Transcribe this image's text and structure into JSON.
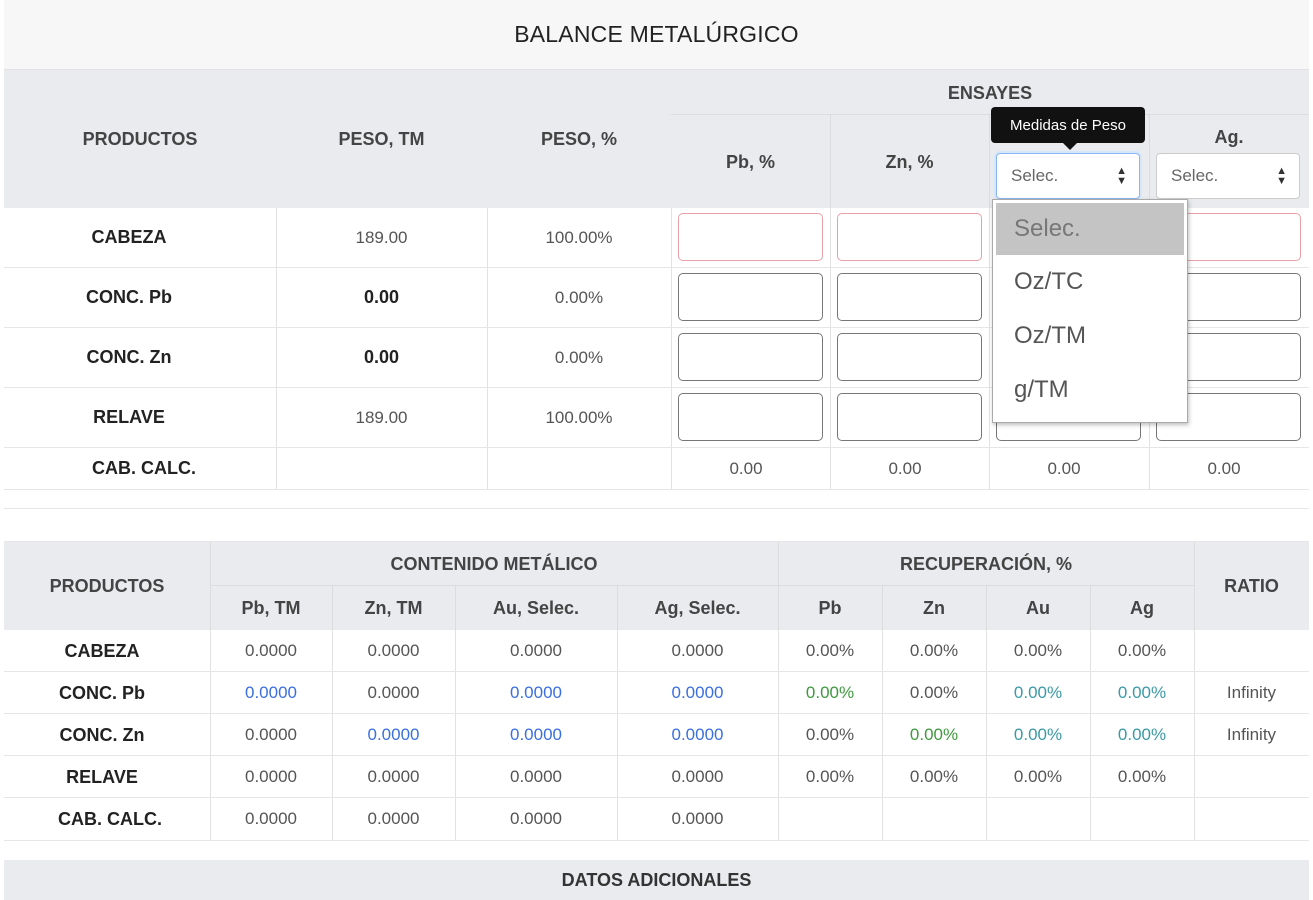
{
  "title": "BALANCE METALÚRGICO",
  "table1": {
    "headers": {
      "productos": "PRODUCTOS",
      "peso_tm": "PESO, TM",
      "peso_pct": "PESO, %",
      "ensayes": "ENSAYES",
      "pb": "Pb, %",
      "zn": "Zn, %",
      "ag": "Ag."
    },
    "selects": {
      "au_value": "Selec.",
      "ag_value": "Selec."
    },
    "tooltip": "Medidas de Peso",
    "dropdown_options": [
      "Selec.",
      "Oz/TC",
      "Oz/TM",
      "g/TM"
    ],
    "rows": [
      {
        "name": "CABEZA",
        "peso_tm": "189.00",
        "peso_pct": "100.00%"
      },
      {
        "name": "CONC. Pb",
        "peso_tm": "0.00",
        "peso_pct": "0.00%"
      },
      {
        "name": "CONC. Zn",
        "peso_tm": "0.00",
        "peso_pct": "0.00%"
      },
      {
        "name": "RELAVE",
        "peso_tm": "189.00",
        "peso_pct": "100.00%"
      }
    ],
    "calc_row": {
      "name": "CAB. CALC.",
      "values": [
        "0.00",
        "0.00",
        "0.00",
        "0.00"
      ]
    }
  },
  "table2": {
    "headers": {
      "productos": "PRODUCTOS",
      "contenido": "CONTENIDO METÁLICO",
      "recuperacion": "RECUPERACIÓN, %",
      "ratio": "RATIO",
      "sub": [
        "Pb, TM",
        "Zn, TM",
        "Au, Selec.",
        "Ag, Selec.",
        "Pb",
        "Zn",
        "Au",
        "Ag"
      ]
    },
    "rows": [
      {
        "name": "CABEZA",
        "values": [
          "0.0000",
          "0.0000",
          "0.0000",
          "0.0000",
          "0.00%",
          "0.00%",
          "0.00%",
          "0.00%"
        ],
        "ratio": ""
      },
      {
        "name": "CONC. Pb",
        "values": [
          "0.0000",
          "0.0000",
          "0.0000",
          "0.0000",
          "0.00%",
          "0.00%",
          "0.00%",
          "0.00%"
        ],
        "ratio": "Infinity"
      },
      {
        "name": "CONC. Zn",
        "values": [
          "0.0000",
          "0.0000",
          "0.0000",
          "0.0000",
          "0.00%",
          "0.00%",
          "0.00%",
          "0.00%"
        ],
        "ratio": "Infinity"
      },
      {
        "name": "RELAVE",
        "values": [
          "0.0000",
          "0.0000",
          "0.0000",
          "0.0000",
          "0.00%",
          "0.00%",
          "0.00%",
          "0.00%"
        ],
        "ratio": ""
      },
      {
        "name": "CAB. CALC.",
        "values": [
          "0.0000",
          "0.0000",
          "0.0000",
          "0.0000"
        ],
        "ratio": ""
      }
    ]
  },
  "footer": "DATOS ADICIONALES",
  "colors": {
    "highlight_blue": "#3b6fe0",
    "highlight_green": "#3e9a3e",
    "highlight_teal": "#3a9aa6",
    "error_border": "#e8a0a8"
  }
}
